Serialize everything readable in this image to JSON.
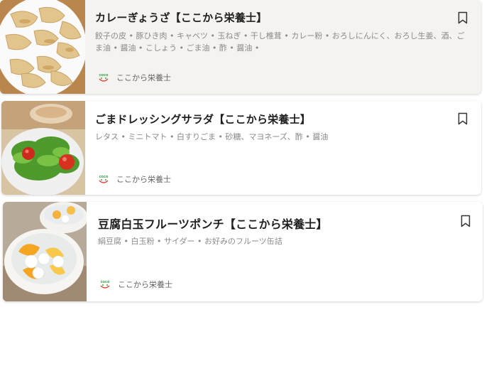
{
  "recipes": [
    {
      "title": "カレーぎょうざ【ここから栄養士】",
      "ingredients": "餃子の皮 • 豚ひき肉 • キャベツ • 玉ねぎ • 干し椎茸 • カレー粉 • おろしにんにく、おろし生姜、酒、ごま油 • 醤油 • こしょう • ごま油 • 酢 • 醤油 •",
      "author": "ここから栄養士",
      "author_logo": "coco-logo",
      "image": "gyoza-photo"
    },
    {
      "title": "ごまドレッシングサラダ【ここから栄養士】",
      "ingredients": "レタス • ミニトマト • 白すりごま • 砂糖、マヨネーズ、酢 • 醤油",
      "author": "ここから栄養士",
      "author_logo": "coco-logo",
      "image": "salad-photo"
    },
    {
      "title": "豆腐白玉フルーツポンチ【ここから栄養士】",
      "ingredients": "絹豆腐 • 白玉粉 • サイダー • お好みのフルーツ缶詰",
      "author": "ここから栄養士",
      "author_logo": "coco-logo",
      "image": "fruit-punch-photo"
    }
  ],
  "bookmark_icon": "bookmark-icon",
  "colors": {
    "hover_bg": "#f5f3ef",
    "logo_green": "#3aa64a",
    "logo_red": "#e0463c"
  }
}
